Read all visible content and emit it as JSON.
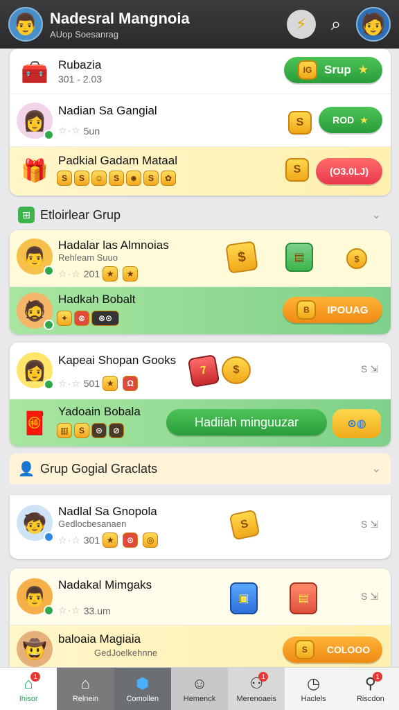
{
  "header": {
    "title": "Nadesral Mangnoia",
    "subtitle": "AUop Soesanrag",
    "avatar_icon": "person-avatar-icon",
    "action_icon": "bolt-icon",
    "search_icon": "search-icon"
  },
  "card1": {
    "rows": [
      {
        "name": "Rubazia",
        "sub": "301 - 2.03",
        "button": "Srup"
      },
      {
        "name": "Nadian Sa Gangial",
        "sub": "5un",
        "button": "ROD"
      },
      {
        "name": "Padkial Gadam Mataal",
        "button": "(O3.0LJ)"
      }
    ]
  },
  "section1": {
    "title": "Etloirlear Grup"
  },
  "card2": {
    "rows": [
      {
        "name": "Hadalar las Almnoias",
        "sub": "Rehleam Suuo",
        "meta": "201"
      },
      {
        "name": "Hadkah Bobalt",
        "button": "IPOUAG"
      }
    ]
  },
  "card3": {
    "rows": [
      {
        "name": "Kapeai Shopan Gooks",
        "meta": "501",
        "arrow": "S ⇲"
      },
      {
        "name": "Yadoain Bobala",
        "button": "Hadiiah minguuzar"
      }
    ]
  },
  "section2": {
    "title": "Grup Gogial Graclats"
  },
  "card4": {
    "rows": [
      {
        "name": "Nadlal Sa Gnopola",
        "sub": "Gedlocbesanaen",
        "meta": "301",
        "arrow": "S ⇲"
      }
    ]
  },
  "card5": {
    "rows": [
      {
        "name": "Nadakal Mimgaks",
        "meta": "33.um",
        "arrow": "S ⇲"
      },
      {
        "name": "baloaia Magiaia",
        "sub": "GedJoelkehnne",
        "button": "COLOOO"
      }
    ]
  },
  "nav": [
    {
      "label": "Ihisor",
      "icon": "home-icon",
      "badge": "1"
    },
    {
      "label": "Relnein",
      "icon": "house-icon"
    },
    {
      "label": "Comollen",
      "icon": "shield-icon"
    },
    {
      "label": "Hemenck",
      "icon": "smile-icon"
    },
    {
      "label": "Merenoaeis",
      "icon": "users-icon",
      "badge": "1"
    },
    {
      "label": "Haclels",
      "icon": "clock-icon"
    },
    {
      "label": "Riscdon",
      "icon": "user-icon",
      "badge": "1"
    }
  ],
  "colors": {
    "accent_green": "#2a9c3a",
    "accent_red": "#e8384b",
    "accent_orange": "#f08a12",
    "header_bg": "#2a2a2c"
  }
}
